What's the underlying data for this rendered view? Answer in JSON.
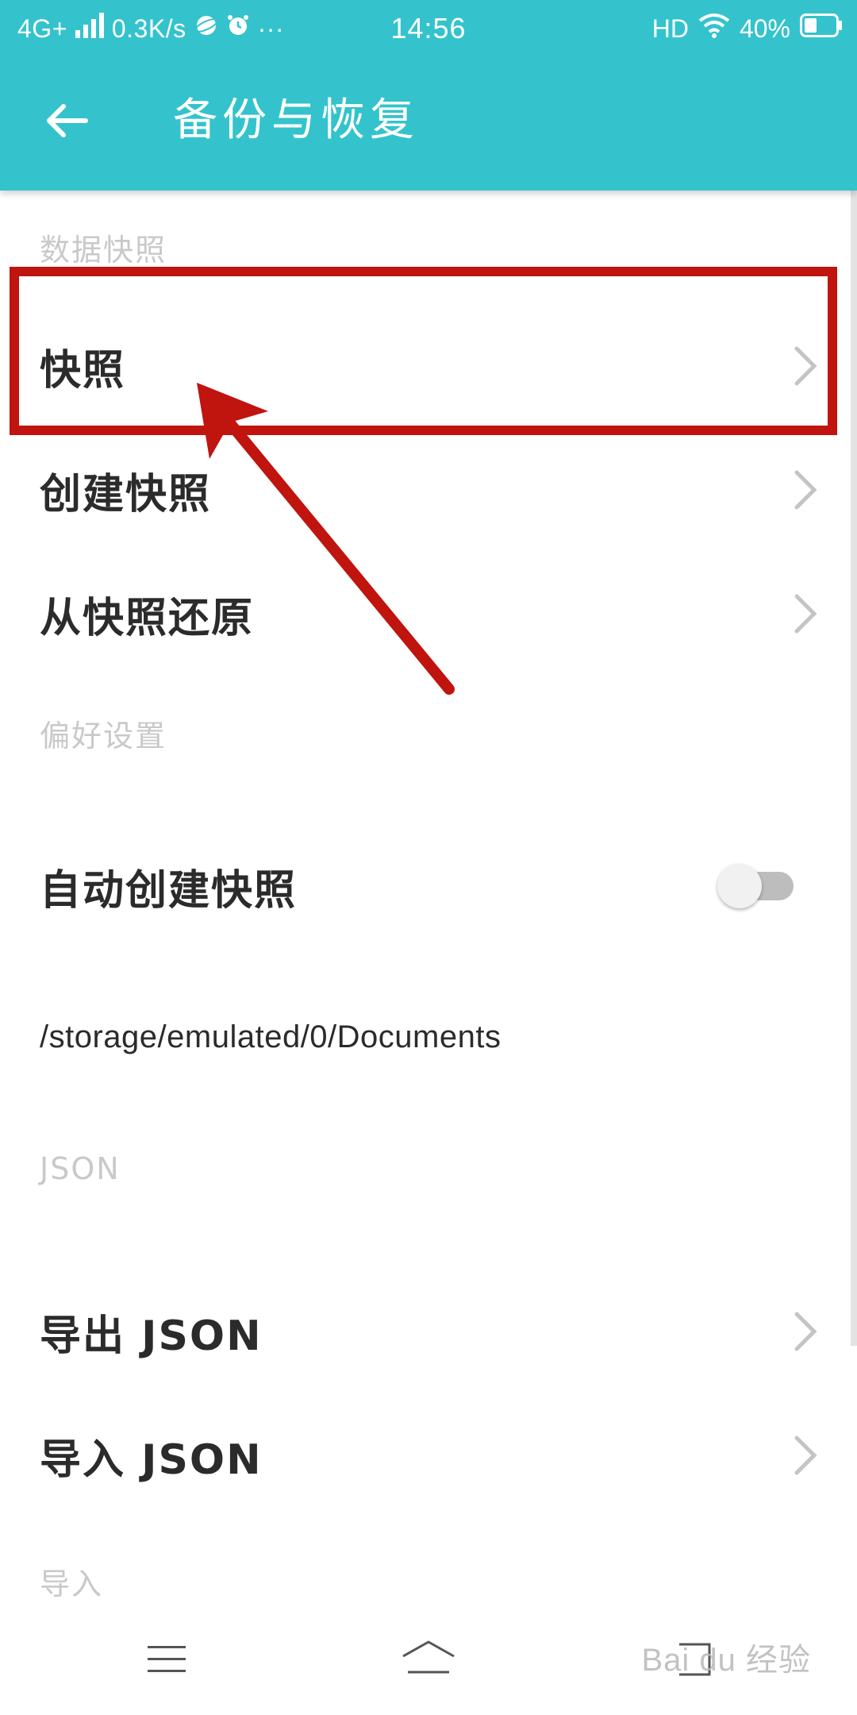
{
  "status_bar": {
    "network": "4G+",
    "speed": "0.3K/s",
    "more": "···",
    "time": "14:56",
    "hd": "HD",
    "battery_percent": "40%",
    "battery_level": 0.4
  },
  "toolbar": {
    "title": "备份与恢复",
    "back_icon": "arrow-left-icon"
  },
  "sections": {
    "snapshot_header": "数据快照",
    "snapshot_item": "快照",
    "create_snapshot_item": "创建快照",
    "restore_snapshot_item": "从快照还原",
    "preferences_header": "偏好设置",
    "auto_snapshot_item": "自动创建快照",
    "auto_snapshot_enabled": false,
    "storage_path": "/storage/emulated/0/Documents",
    "json_header": "JSON",
    "export_json_item": "导出 JSON",
    "import_json_item": "导入 JSON",
    "import_header": "导入"
  },
  "navbar": {
    "menu_icon": "menu-icon",
    "home_icon": "home-icon",
    "back_icon": "back-icon"
  },
  "watermark": "Bai du 经验",
  "colors": {
    "accent": "#34c3cc",
    "annotation": "#c0140f",
    "section_header": "#c9c9c9",
    "text": "#2b2b2b"
  }
}
